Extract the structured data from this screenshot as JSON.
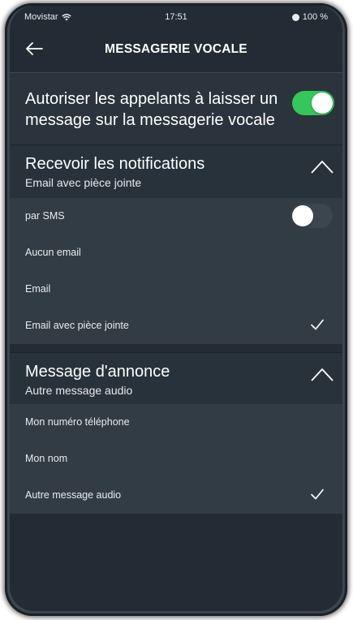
{
  "status_bar": {
    "carrier": "Movistar",
    "time": "17:51",
    "battery": "100 %"
  },
  "header": {
    "title": "MESSAGERIE VOCALE"
  },
  "allow_callers": {
    "label": "Autoriser les appelants à laisser un message sur la messagerie vocale",
    "enabled": true
  },
  "notifications": {
    "title": "Recevoir les notifications",
    "selected": "Email avec pièce jointe",
    "sms": {
      "label": "par SMS",
      "enabled": false
    },
    "options": [
      "Aucun email",
      "Email",
      "Email avec pièce jointe"
    ]
  },
  "announcement": {
    "title": "Message d'annonce",
    "selected": "Autre message audio",
    "options": [
      "Mon numéro téléphone",
      "Mon nom",
      "Autre message audio"
    ]
  },
  "colors": {
    "toggle_on": "#34c759",
    "background": "#232c34"
  }
}
